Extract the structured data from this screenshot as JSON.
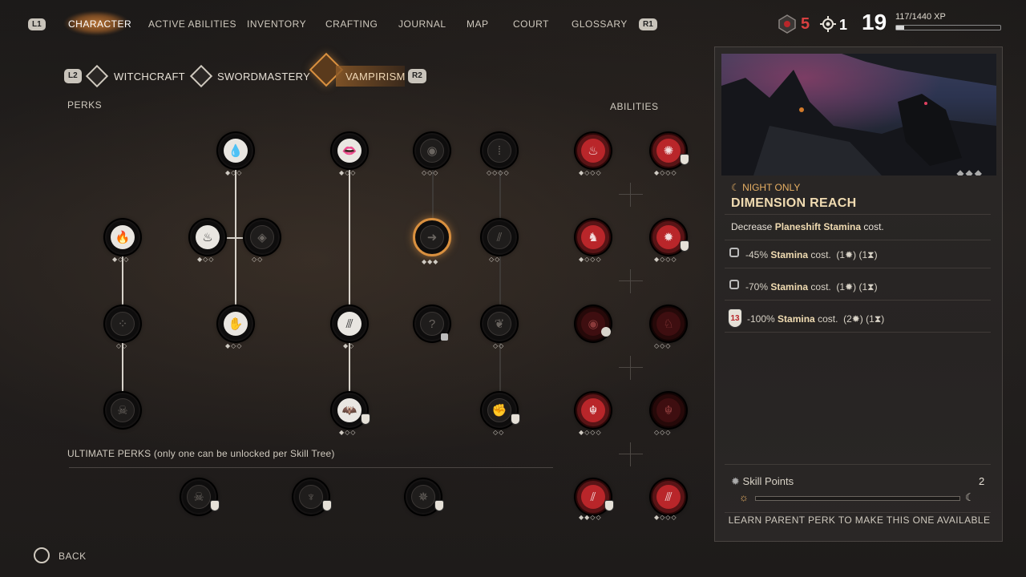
{
  "topbar": {
    "left_button": "L1",
    "right_button": "R1",
    "nav": [
      "CHARACTER",
      "ACTIVE ABILITIES",
      "INVENTORY",
      "CRAFTING",
      "JOURNAL",
      "MAP",
      "COURT",
      "GLOSSARY"
    ],
    "active_tab": "CHARACTER",
    "currency_red": "5",
    "skill_points": "1",
    "level": "19",
    "xp": "117/1440 XP",
    "xp_fraction": 0.08
  },
  "subtabs": {
    "left_button": "L2",
    "right_button": "R2",
    "items": [
      "WITCHCRAFT",
      "SWORDMASTERY",
      "VAMPIRISM"
    ],
    "active": "VAMPIRISM"
  },
  "labels": {
    "perks": "PERKS",
    "abilities": "ABILITIES",
    "ultimate": "ULTIMATE PERKS (only one can be unlocked per Skill Tree)",
    "back": "BACK"
  },
  "detail": {
    "tag": "NIGHT ONLY",
    "title": "DIMENSION REACH",
    "desc_prefix": "Decrease",
    "desc_bold": "Planeshift Stamina",
    "desc_suffix": "cost.",
    "tiers": [
      {
        "value": "-45%",
        "stat": "Stamina",
        "suffix": "cost.",
        "cost1": "(1",
        "cost2": "(1",
        "locked": true
      },
      {
        "value": "-70%",
        "stat": "Stamina",
        "suffix": "cost.",
        "cost1": "(1",
        "cost2": "(1",
        "locked": true
      },
      {
        "value": "-100%",
        "stat": "Stamina",
        "suffix": "cost.",
        "cost1": "(2",
        "cost2": "(1",
        "locked": false,
        "badge": "13"
      }
    ],
    "skill_points_label": "Skill Points",
    "skill_points_value": "2",
    "footer": "LEARN PARENT PERK TO MAKE THIS ONE AVAILABLE"
  },
  "colors": {
    "accent_orange": "#d9903f",
    "accent_red": "#b9262a",
    "text_gold": "#f1dcb2"
  }
}
